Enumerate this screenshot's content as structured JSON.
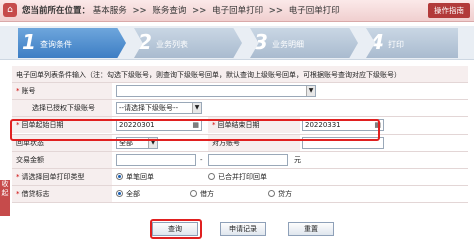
{
  "header": {
    "location_label": "您当前所在位置：",
    "crumbs": [
      "基本服务",
      "账务查询",
      "电子回单打印",
      "电子回单打印"
    ],
    "separator": ">>",
    "help_label": "操作指南"
  },
  "steps": [
    {
      "num": "1",
      "label": "查询条件"
    },
    {
      "num": "2",
      "label": "业务列表"
    },
    {
      "num": "3",
      "label": "业务明细"
    },
    {
      "num": "4",
      "label": "打印"
    }
  ],
  "form": {
    "note": "电子回单列表条件输入（注：勾选下级账号，则查询下级账号回单，默认查询上级账号回单，可根据账号查询对应下级账号）",
    "account_label": "账号",
    "sub_account_label": "选择已授权下级账号",
    "sub_account_value": "--请选择下级账号--",
    "start_date_label": "回单起始日期",
    "start_date_value": "20220301",
    "end_date_label": "回单结束日期",
    "end_date_value": "20220331",
    "status_label": "回单状态",
    "status_value": "全部",
    "peer_account_label": "对方账号",
    "amount_label": "交易金额",
    "amount_unit": "元",
    "print_type_label": "请选择回单打印类型",
    "print_type_options": [
      "单笔回单",
      "已合并打印回单"
    ],
    "debit_credit_label": "借贷标志",
    "debit_credit_options": [
      "全部",
      "借方",
      "贷方"
    ]
  },
  "buttons": {
    "query": "查询",
    "apply_record": "申请记录",
    "reset": "重置"
  },
  "side_tab": "收起"
}
